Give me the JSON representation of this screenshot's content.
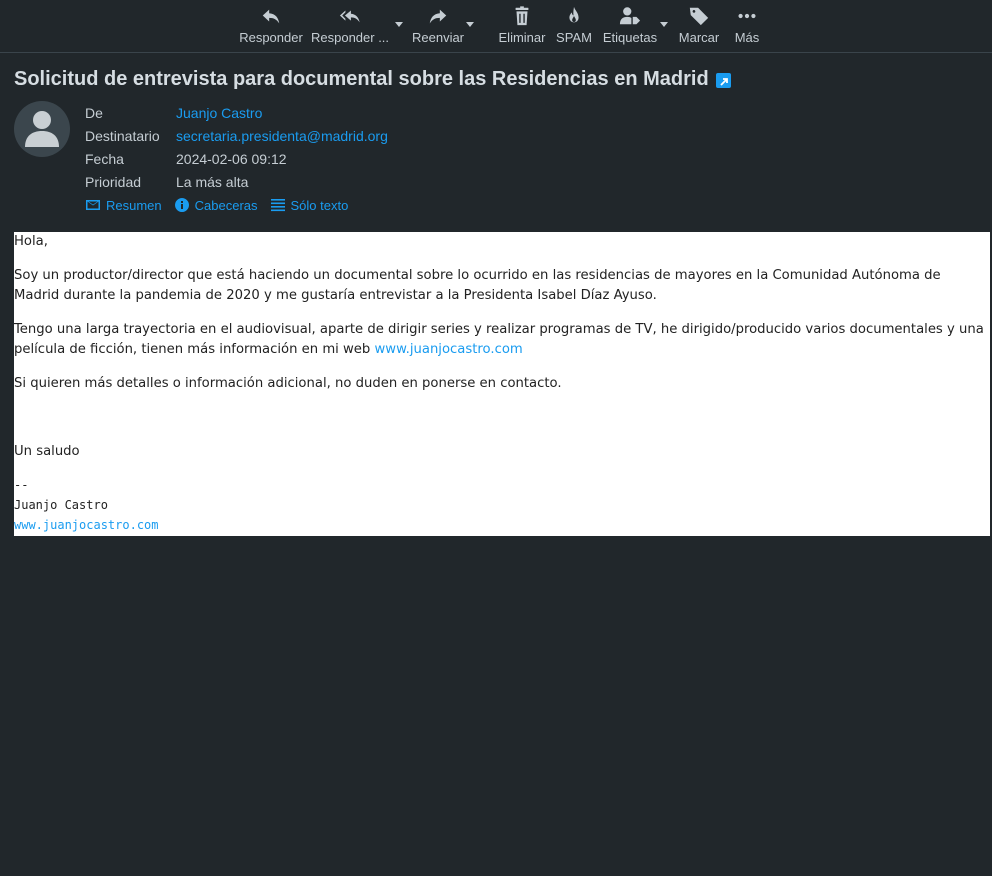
{
  "toolbar": {
    "reply": "Responder",
    "reply_all": "Responder ...",
    "forward": "Reenviar",
    "delete": "Eliminar",
    "spam": "SPAM",
    "labels": "Etiquetas",
    "mark": "Marcar",
    "more": "Más"
  },
  "message": {
    "subject": "Solicitud de entrevista para documental sobre las Residencias en Madrid",
    "from_label": "De",
    "from": "Juanjo Castro",
    "to_label": "Destinatario",
    "to": "secretaria.presidenta@madrid.org",
    "date_label": "Fecha",
    "date": "2024-02-06 09:12",
    "priority_label": "Prioridad",
    "priority": "La más alta"
  },
  "views": {
    "summary": "Resumen",
    "headers": "Cabeceras",
    "plain": "Sólo texto"
  },
  "body": {
    "greeting": "Hola,",
    "p1": "Soy un productor/director que está haciendo un documental sobre lo ocurrido en las residencias de mayores en la Comunidad Autónoma de Madrid durante la pandemia de 2020 y me gustaría entrevistar a la Presidenta Isabel Díaz Ayuso.",
    "p2_text": "Tengo una larga trayectoria en el audiovisual, aparte de dirigir series y realizar programas de TV, he dirigido/producido varios documentales y una película de ficción, tienen más información en mi web ",
    "p2_link": "www.juanjocastro.com",
    "p3": "Si quieren más detalles o información adicional, no duden en ponerse en contacto.",
    "closing": "Un saludo",
    "sig_sep": "--",
    "sig_name": "Juanjo Castro",
    "sig_link": "www.juanjocastro.com"
  }
}
